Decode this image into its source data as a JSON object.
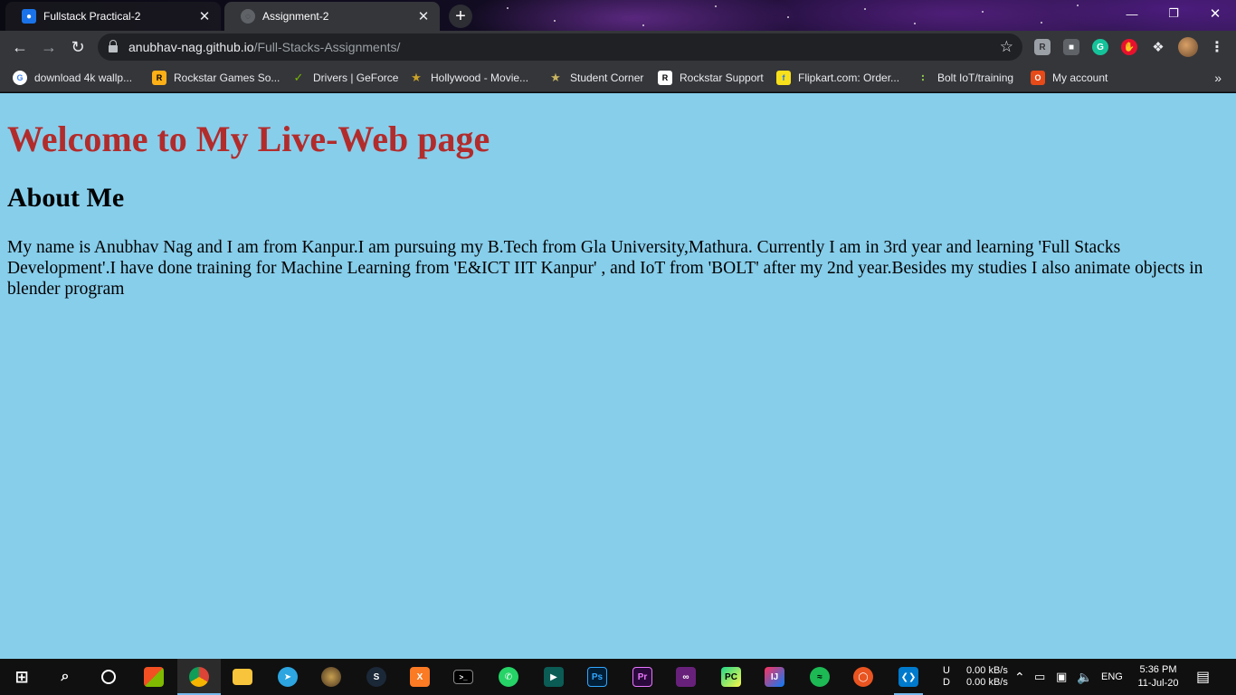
{
  "tabs": [
    {
      "title": "Fullstack Practical-2",
      "favicon": "classroom-icon",
      "active": false
    },
    {
      "title": "Assignment-2",
      "favicon": "globe-icon",
      "active": true
    }
  ],
  "toolbar": {
    "url_host": "anubhav-nag.github.io",
    "url_path": "/Full-Stacks-Assignments/"
  },
  "bookmarks": [
    {
      "label": "download 4k wallp...",
      "icon": "google-icon"
    },
    {
      "label": "Rockstar Games So...",
      "icon": "rockstar-icon"
    },
    {
      "label": "Drivers | GeForce",
      "icon": "nvidia-icon"
    },
    {
      "label": "Hollywood - Movie...",
      "icon": "movie-icon"
    },
    {
      "label": "Student Corner",
      "icon": "student-icon"
    },
    {
      "label": "Rockstar Support",
      "icon": "rockstar-support-icon"
    },
    {
      "label": "Flipkart.com: Order...",
      "icon": "flipkart-icon"
    },
    {
      "label": "Bolt IoT/training",
      "icon": "bolt-icon"
    },
    {
      "label": "My account",
      "icon": "office-icon"
    }
  ],
  "page": {
    "heading": "Welcome to My Live-Web page",
    "subheading": "About Me",
    "paragraph": "My name is Anubhav Nag and I am from Kanpur.I am pursuing my B.Tech from Gla University,Mathura. Currently I am in 3rd year and learning 'Full Stacks Development'.I have done training for Machine Learning from 'E&ICT IIT Kanpur' , and IoT from 'BOLT' after my 2nd year.Besides my studies I also animate objects in blender program",
    "background_color": "#87ceeb",
    "heading_color": "#b22c2c"
  },
  "taskbar": {
    "net_upload_label": "U",
    "net_download_label": "D",
    "net_upload": "0.00 kB/s",
    "net_download": "0.00 kB/s",
    "language": "ENG",
    "time": "5:36 PM",
    "date": "11-Jul-20"
  }
}
